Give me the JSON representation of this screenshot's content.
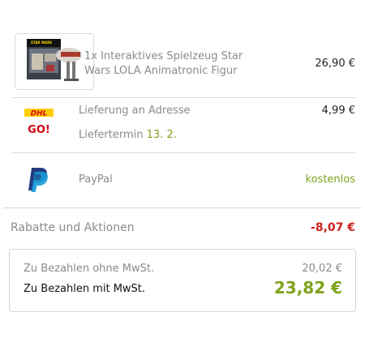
{
  "item": {
    "title": "1x Interaktives Spielzeug Star Wars LOLA Animatronic Figur",
    "price": "26,90 €",
    "thumbnail_brand": "STAR WARS"
  },
  "shipping": {
    "carrier_logo_text": "DHL",
    "carrier_logo_sub": "GO!",
    "label": "Lieferung an Adresse",
    "price": "4,99 €",
    "date_label": "Liefertermin",
    "date_value": "13. 2."
  },
  "payment": {
    "label": "PayPal",
    "price": "kostenlos"
  },
  "discounts": {
    "label": "Rabatte und Aktionen",
    "value": "-8,07 €"
  },
  "totals": {
    "net_label": "Zu Bezahlen ohne MwSt.",
    "net_value": "20,02 €",
    "gross_label": "Zu Bezahlen mit MwSt.",
    "gross_value": "23,82 €"
  },
  "colors": {
    "accent_green": "#7fa21b",
    "discount_red": "#cc1e1e",
    "dhl_yellow": "#ffcc00",
    "dhl_red": "#d40511",
    "paypal_dark": "#253b80",
    "paypal_light": "#179bd7"
  }
}
